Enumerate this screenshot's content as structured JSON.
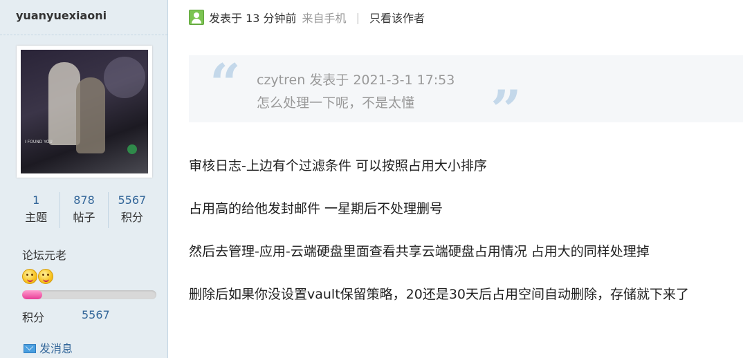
{
  "user": {
    "name": "yuanyuexiaoni",
    "stats": [
      {
        "num": "1",
        "label": "主题"
      },
      {
        "num": "878",
        "label": "帖子"
      },
      {
        "num": "5567",
        "label": "积分"
      }
    ],
    "level": "论坛元老",
    "progress_fraction": 0.15,
    "score_label": "积分",
    "score_value": "5567",
    "send_message": "发消息",
    "avatar_caption": "I FOUND YOU"
  },
  "post": {
    "time": "发表于 13 分钟前",
    "from": "来自手机",
    "separator": "|",
    "only_author": "只看该作者",
    "quote": {
      "header": "czytren 发表于 2021-3-1 17:53",
      "body": "怎么处理一下呢，不是太懂"
    },
    "lines": [
      "审核日志-上边有个过滤条件 可以按照占用大小排序",
      "占用高的给他发封邮件 一星期后不处理删号",
      "然后去管理-应用-云端硬盘里面查看共享云端硬盘占用情况 占用大的同样处理掉",
      "删除后如果你没设置vault保留策略，20还是30天后占用空间自动删除，存储就下来了"
    ]
  },
  "colors": {
    "sidebar_bg": "#e5edf2",
    "link": "#336699",
    "progress": "#e83d97"
  }
}
